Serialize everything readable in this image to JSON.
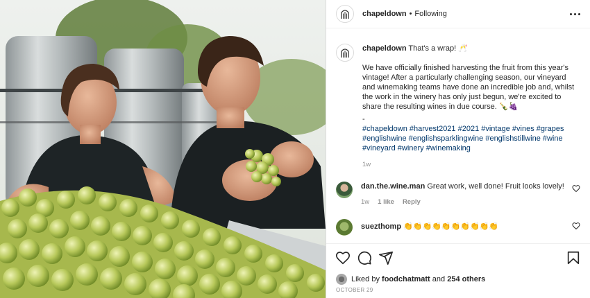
{
  "post": {
    "header": {
      "username": "chapeldown",
      "separator": "•",
      "follow_label": "Following",
      "more_icon": "more-horizontal-icon"
    },
    "caption": {
      "username": "chapeldown",
      "first_line": "That's a wrap! 🥂",
      "body": "We have officially finished harvesting the fruit from this year's vintage! After a particularly challenging season, our vineyard and winemaking teams have done an incredible job and, whilst the work in the winery has only just begun, we're excited to share the resulting wines in due course. 🍾🍇",
      "dash": "-",
      "hashtags": "#chapeldown #harvest2021 #2021 #vintage #vines #grapes #englishwine #englishsparklingwine #englishstillwine #wine #vineyard #winery #winemaking",
      "time": "1w"
    },
    "comments": [
      {
        "username": "dan.the.wine.man",
        "text": "Great work, well done! Fruit looks lovely!",
        "time": "1w",
        "likes": "1 like",
        "reply": "Reply"
      },
      {
        "username": "suezthomp",
        "text": "👏👏👏👏👏👏👏👏👏👏",
        "time": "",
        "likes": "",
        "reply": ""
      }
    ],
    "likes": {
      "prefix": "Liked by",
      "user": "foodchatmatt",
      "and": "and",
      "others": "254 others"
    },
    "date": "OCTOBER 29"
  },
  "colors": {
    "text": "#262626",
    "muted": "#8e8e8e",
    "hashtag": "#00376b",
    "border": "#dbdbdb"
  }
}
